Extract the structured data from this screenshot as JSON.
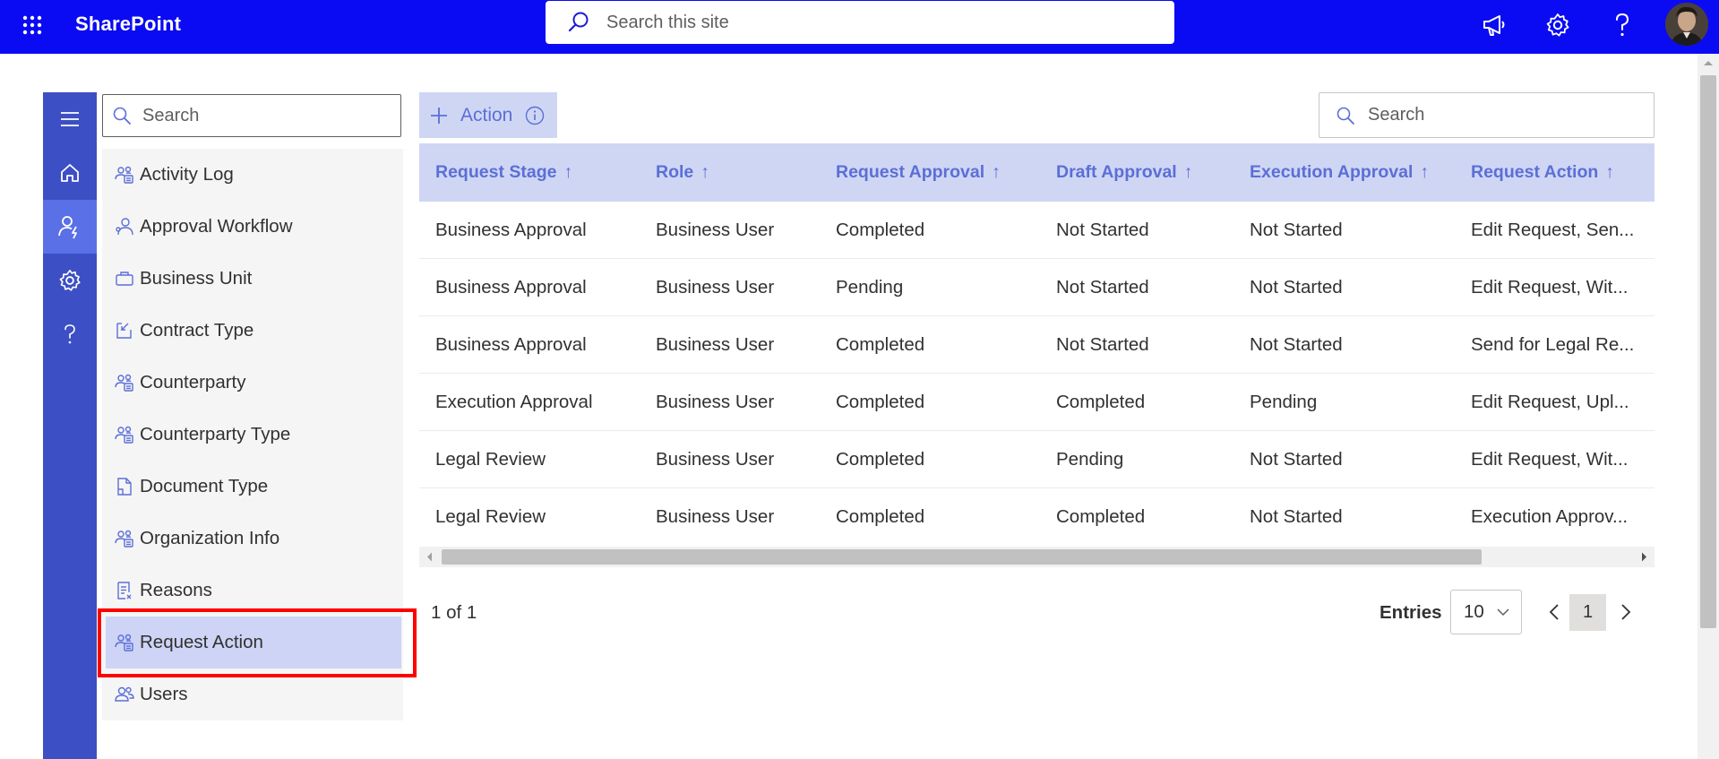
{
  "app": {
    "name": "SharePoint"
  },
  "site_search": {
    "placeholder": "Search this site"
  },
  "nav": {
    "search_placeholder": "Search",
    "items": [
      {
        "label": "Activity Log",
        "icon": "people-icon"
      },
      {
        "label": "Approval Workflow",
        "icon": "person-icon"
      },
      {
        "label": "Business Unit",
        "icon": "briefcase-icon"
      },
      {
        "label": "Contract Type",
        "icon": "contract-icon"
      },
      {
        "label": "Counterparty",
        "icon": "people-icon"
      },
      {
        "label": "Counterparty Type",
        "icon": "people-icon"
      },
      {
        "label": "Document Type",
        "icon": "document-icon"
      },
      {
        "label": "Organization Info",
        "icon": "people-icon"
      },
      {
        "label": "Reasons",
        "icon": "list-icon"
      },
      {
        "label": "Request Action",
        "icon": "people-icon"
      },
      {
        "label": "Users",
        "icon": "users-icon"
      }
    ],
    "selected": "Request Action"
  },
  "toolbar": {
    "action_label": "Action",
    "search_placeholder": "Search"
  },
  "table": {
    "columns": [
      "Request Stage",
      "Role",
      "Request Approval",
      "Draft Approval",
      "Execution Approval",
      "Request Action"
    ],
    "sort_glyph": "↑",
    "rows": [
      [
        "Business Approval",
        "Business User",
        "Completed",
        "Not Started",
        "Not Started",
        "Edit Request, Sen..."
      ],
      [
        "Business Approval",
        "Business User",
        "Pending",
        "Not Started",
        "Not Started",
        "Edit Request, Wit..."
      ],
      [
        "Business Approval",
        "Business User",
        "Completed",
        "Not Started",
        "Not Started",
        "Send for Legal Re..."
      ],
      [
        "Execution Approval",
        "Business User",
        "Completed",
        "Completed",
        "Pending",
        "Edit Request, Upl..."
      ],
      [
        "Legal Review",
        "Business User",
        "Completed",
        "Pending",
        "Not Started",
        "Edit Request, Wit..."
      ],
      [
        "Legal Review",
        "Business User",
        "Completed",
        "Completed",
        "Not Started",
        "Execution Approv..."
      ]
    ]
  },
  "pagination": {
    "summary": "1 of 1",
    "entries_label": "Entries",
    "entries_value": "10",
    "current_page": "1"
  },
  "colors": {
    "topbar": "#0b0bf3",
    "rail": "#3d4fc4",
    "accent": "#5b6fd6",
    "header_bg": "#cfd6f4",
    "selected_bg": "#cdd4f5",
    "highlight": "#ff0000"
  }
}
